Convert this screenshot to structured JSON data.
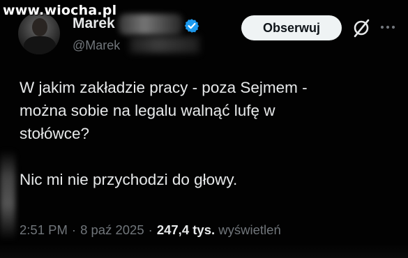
{
  "watermark": "www.wiocha.pl",
  "author": {
    "display_name": "Marek",
    "handle": "@Marek"
  },
  "header": {
    "follow_label": "Obserwuj"
  },
  "tweet": {
    "paragraph_1": "W jakim zakładzie pracy - poza Sejmem -\nmożna sobie na legalu walnąć lufę w\nstołówce?",
    "paragraph_2": "Nic mi nie przychodzi do głowy."
  },
  "meta": {
    "time": "2:51 PM",
    "date": "8 paź 2025",
    "views_count": "247,4 tys.",
    "views_label": "wyświetleń",
    "separator": "·"
  },
  "colors": {
    "background": "#000000",
    "text_primary": "#e7e9ea",
    "text_secondary": "#71767b",
    "verified_blue": "#1d9bf0",
    "button_bg": "#eff3f4"
  },
  "icons": {
    "verified": "verified-badge-icon",
    "grok": "grok-icon",
    "more": "more-options-icon"
  }
}
